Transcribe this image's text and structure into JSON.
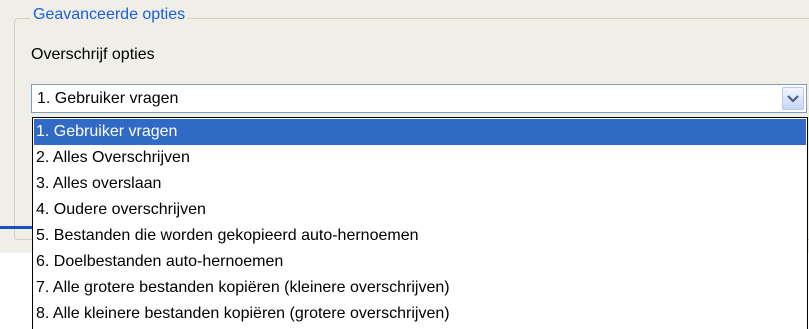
{
  "group": {
    "title": "Geavanceerde opties",
    "overwrite_label": "Overschrijf opties"
  },
  "combo": {
    "selected_value": "1. Gebruiker vragen",
    "arrow_icon": "chevron-down-icon"
  },
  "dropdown": {
    "selected_index": 0,
    "options": [
      "1. Gebruiker vragen",
      "2. Alles Overschrijven",
      "3. Alles overslaan",
      "4. Oudere overschrijven",
      "5. Bestanden die worden gekopieerd auto-hernoemen",
      "6. Doelbestanden auto-hernoemen",
      "7. Alle grotere bestanden kopiëren (kleinere overschrijven)",
      "8. Alle kleinere bestanden kopiëren (grotere overschrijven)"
    ]
  },
  "colors": {
    "legend_text": "#1a5fd9",
    "selection_bg": "#316ac5",
    "panel_bg": "#efeee7"
  }
}
